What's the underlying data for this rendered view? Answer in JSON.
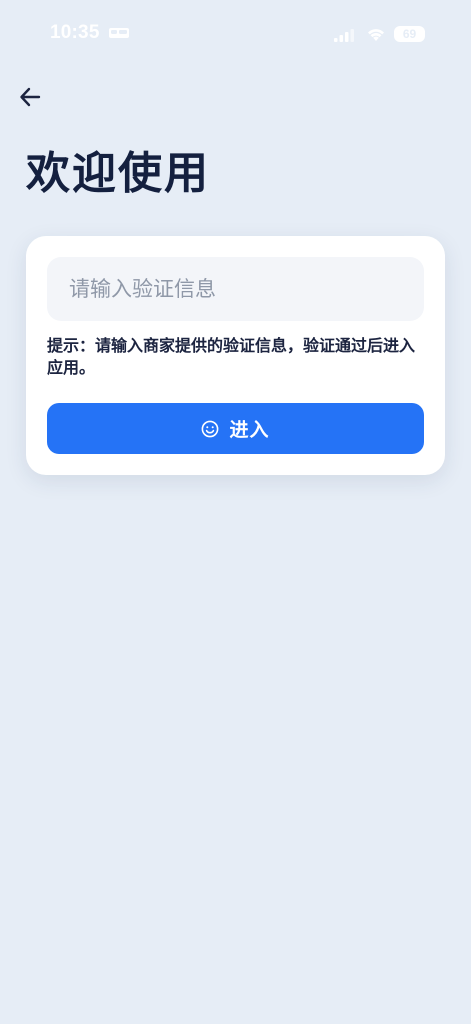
{
  "status_bar": {
    "time": "10:35",
    "sleep_icon": "bed-icon",
    "signal_icon": "cellular-signal-icon",
    "wifi_icon": "wifi-icon",
    "battery_level": "69"
  },
  "nav": {
    "back_icon": "arrow-left-icon"
  },
  "page": {
    "title": "欢迎使用"
  },
  "form": {
    "input_value": "",
    "input_placeholder": "请输入验证信息",
    "hint": "提示：请输入商家提供的验证信息，验证通过后进入应用。",
    "submit_icon": "smile-icon",
    "submit_label": "进入"
  },
  "colors": {
    "background": "#e6edf6",
    "accent": "#2573f6",
    "card": "#ffffff",
    "input_fill": "#f3f5f9",
    "title_text": "#14203f"
  }
}
